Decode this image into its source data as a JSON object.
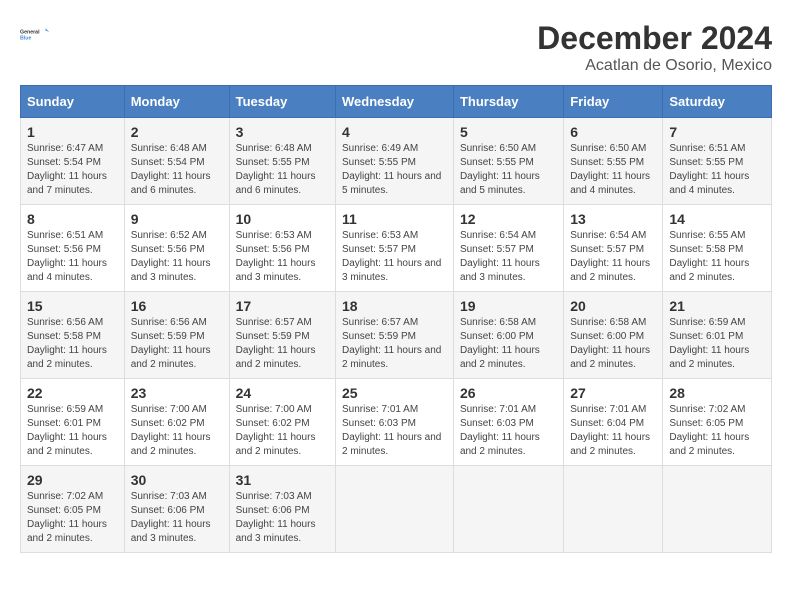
{
  "logo": {
    "line1": "General",
    "line2": "Blue"
  },
  "title": "December 2024",
  "subtitle": "Acatlan de Osorio, Mexico",
  "days_of_week": [
    "Sunday",
    "Monday",
    "Tuesday",
    "Wednesday",
    "Thursday",
    "Friday",
    "Saturday"
  ],
  "weeks": [
    [
      {
        "day": "1",
        "sunrise": "6:47 AM",
        "sunset": "5:54 PM",
        "daylight": "11 hours and 7 minutes."
      },
      {
        "day": "2",
        "sunrise": "6:48 AM",
        "sunset": "5:54 PM",
        "daylight": "11 hours and 6 minutes."
      },
      {
        "day": "3",
        "sunrise": "6:48 AM",
        "sunset": "5:55 PM",
        "daylight": "11 hours and 6 minutes."
      },
      {
        "day": "4",
        "sunrise": "6:49 AM",
        "sunset": "5:55 PM",
        "daylight": "11 hours and 5 minutes."
      },
      {
        "day": "5",
        "sunrise": "6:50 AM",
        "sunset": "5:55 PM",
        "daylight": "11 hours and 5 minutes."
      },
      {
        "day": "6",
        "sunrise": "6:50 AM",
        "sunset": "5:55 PM",
        "daylight": "11 hours and 4 minutes."
      },
      {
        "day": "7",
        "sunrise": "6:51 AM",
        "sunset": "5:55 PM",
        "daylight": "11 hours and 4 minutes."
      }
    ],
    [
      {
        "day": "8",
        "sunrise": "6:51 AM",
        "sunset": "5:56 PM",
        "daylight": "11 hours and 4 minutes."
      },
      {
        "day": "9",
        "sunrise": "6:52 AM",
        "sunset": "5:56 PM",
        "daylight": "11 hours and 3 minutes."
      },
      {
        "day": "10",
        "sunrise": "6:53 AM",
        "sunset": "5:56 PM",
        "daylight": "11 hours and 3 minutes."
      },
      {
        "day": "11",
        "sunrise": "6:53 AM",
        "sunset": "5:57 PM",
        "daylight": "11 hours and 3 minutes."
      },
      {
        "day": "12",
        "sunrise": "6:54 AM",
        "sunset": "5:57 PM",
        "daylight": "11 hours and 3 minutes."
      },
      {
        "day": "13",
        "sunrise": "6:54 AM",
        "sunset": "5:57 PM",
        "daylight": "11 hours and 2 minutes."
      },
      {
        "day": "14",
        "sunrise": "6:55 AM",
        "sunset": "5:58 PM",
        "daylight": "11 hours and 2 minutes."
      }
    ],
    [
      {
        "day": "15",
        "sunrise": "6:56 AM",
        "sunset": "5:58 PM",
        "daylight": "11 hours and 2 minutes."
      },
      {
        "day": "16",
        "sunrise": "6:56 AM",
        "sunset": "5:59 PM",
        "daylight": "11 hours and 2 minutes."
      },
      {
        "day": "17",
        "sunrise": "6:57 AM",
        "sunset": "5:59 PM",
        "daylight": "11 hours and 2 minutes."
      },
      {
        "day": "18",
        "sunrise": "6:57 AM",
        "sunset": "5:59 PM",
        "daylight": "11 hours and 2 minutes."
      },
      {
        "day": "19",
        "sunrise": "6:58 AM",
        "sunset": "6:00 PM",
        "daylight": "11 hours and 2 minutes."
      },
      {
        "day": "20",
        "sunrise": "6:58 AM",
        "sunset": "6:00 PM",
        "daylight": "11 hours and 2 minutes."
      },
      {
        "day": "21",
        "sunrise": "6:59 AM",
        "sunset": "6:01 PM",
        "daylight": "11 hours and 2 minutes."
      }
    ],
    [
      {
        "day": "22",
        "sunrise": "6:59 AM",
        "sunset": "6:01 PM",
        "daylight": "11 hours and 2 minutes."
      },
      {
        "day": "23",
        "sunrise": "7:00 AM",
        "sunset": "6:02 PM",
        "daylight": "11 hours and 2 minutes."
      },
      {
        "day": "24",
        "sunrise": "7:00 AM",
        "sunset": "6:02 PM",
        "daylight": "11 hours and 2 minutes."
      },
      {
        "day": "25",
        "sunrise": "7:01 AM",
        "sunset": "6:03 PM",
        "daylight": "11 hours and 2 minutes."
      },
      {
        "day": "26",
        "sunrise": "7:01 AM",
        "sunset": "6:03 PM",
        "daylight": "11 hours and 2 minutes."
      },
      {
        "day": "27",
        "sunrise": "7:01 AM",
        "sunset": "6:04 PM",
        "daylight": "11 hours and 2 minutes."
      },
      {
        "day": "28",
        "sunrise": "7:02 AM",
        "sunset": "6:05 PM",
        "daylight": "11 hours and 2 minutes."
      }
    ],
    [
      {
        "day": "29",
        "sunrise": "7:02 AM",
        "sunset": "6:05 PM",
        "daylight": "11 hours and 2 minutes."
      },
      {
        "day": "30",
        "sunrise": "7:03 AM",
        "sunset": "6:06 PM",
        "daylight": "11 hours and 3 minutes."
      },
      {
        "day": "31",
        "sunrise": "7:03 AM",
        "sunset": "6:06 PM",
        "daylight": "11 hours and 3 minutes."
      },
      null,
      null,
      null,
      null
    ]
  ],
  "labels": {
    "sunrise": "Sunrise:",
    "sunset": "Sunset:",
    "daylight": "Daylight:"
  }
}
